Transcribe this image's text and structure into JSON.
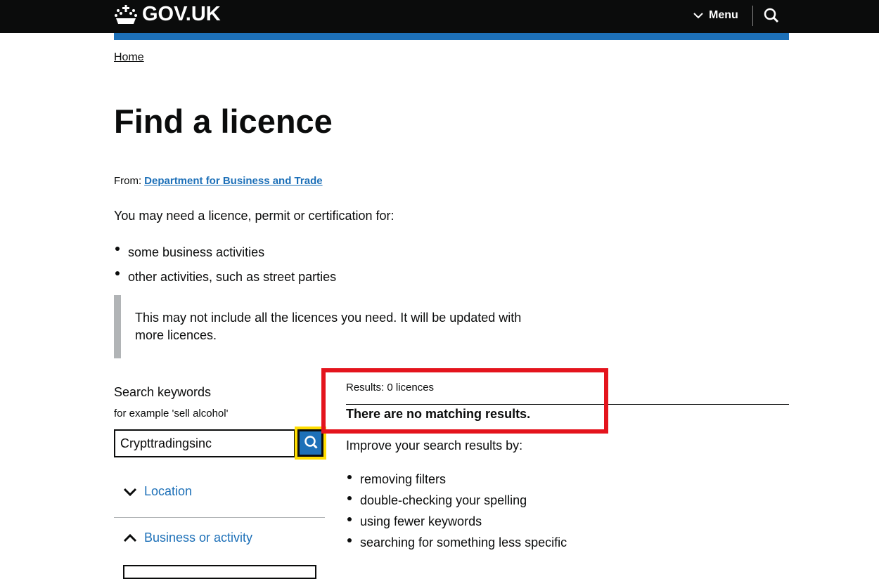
{
  "header": {
    "logo": "GOV.UK",
    "menu": "Menu"
  },
  "breadcrumb": "Home",
  "title": "Find a licence",
  "from": {
    "label": "From:",
    "org": "Department for Business and Trade"
  },
  "intro": "You may need a licence, permit or certification for:",
  "intro_list": [
    "some business activities",
    "other activities, such as street parties"
  ],
  "inset": "This may not include all the licences you need. It will be updated with more licences.",
  "search": {
    "label": "Search keywords",
    "hint": "for example 'sell alcohol'",
    "value": "Crypttradingsinc"
  },
  "facets": [
    "Location",
    "Business or activity"
  ],
  "results": {
    "count": "Results: 0 licences",
    "none": "There are no matching results.",
    "improve": "Improve your search results by:",
    "tips": [
      "removing filters",
      "double-checking your spelling",
      "using fewer keywords",
      "searching for something less specific"
    ]
  }
}
